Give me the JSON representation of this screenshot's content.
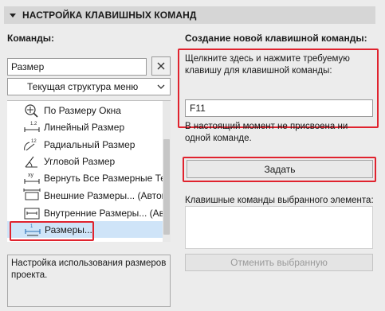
{
  "header": {
    "title": "НАСТРОЙКА КЛАВИШНЫХ КОМАНД"
  },
  "left": {
    "commands_label": "Команды:",
    "search": {
      "value": "Размер"
    },
    "structure_select": {
      "value": "Текущая структура меню"
    },
    "list": [
      {
        "label": "По Размеру Окна",
        "icon": "zoom-fit-icon",
        "selected": false
      },
      {
        "label": "Линейный Размер",
        "icon": "linear-dimension-icon",
        "selected": false
      },
      {
        "label": "Радиальный Размер",
        "icon": "radial-dimension-icon",
        "selected": false
      },
      {
        "label": "Угловой Размер",
        "icon": "angle-dimension-icon",
        "selected": false
      },
      {
        "label": "Вернуть Все Размерные Тексты",
        "icon": "reset-dimension-text-icon",
        "selected": false
      },
      {
        "label": "Внешние Размеры... (Автоматический)",
        "icon": "exterior-dimension-icon",
        "selected": false
      },
      {
        "label": "Внутренние Размеры... (Автоматический)",
        "icon": "interior-dimension-icon",
        "selected": false
      },
      {
        "label": "Размеры...",
        "icon": "dimension-settings-icon",
        "selected": true
      }
    ],
    "description": "Настройка использования размеров проекта."
  },
  "right": {
    "new_shortcut_label": "Создание новой клавишной команды:",
    "instruction": "Щелкните здесь и нажмите требуемую клавишу для клавишной команды:",
    "shortcut_value": "F11",
    "status": "В настоящий момент не присвоена ни одной команде.",
    "assign_button": "Задать",
    "selected_shortcuts_label": "Клавишные команды выбранного элемента:",
    "remove_button": "Отменить выбранную"
  },
  "colors": {
    "highlight": "#e0232e",
    "selection": "#cfe4f8"
  }
}
